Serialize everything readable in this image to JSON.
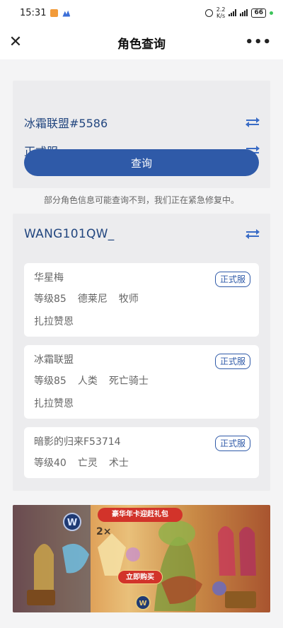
{
  "status_bar": {
    "time": "15:31",
    "rate_top": "2.2",
    "rate_bottom": "K/s",
    "battery": "66",
    "icons": [
      "notification-icon",
      "cloud-icon",
      "alarm-icon",
      "signal-icon",
      "wifi-icon",
      "battery-icon"
    ]
  },
  "nav": {
    "title": "角色查询",
    "close_icon": "close-icon",
    "more_icon": "more-icon"
  },
  "search": {
    "realm": "冰霜联盟#5586",
    "server": "正式服",
    "button": "查询",
    "swap_icon": "swap-icon"
  },
  "notice": "部分角色信息可能查询不到，我们正在紧急修复中。",
  "account": {
    "name": "WANG101QW_"
  },
  "characters": [
    {
      "name": "华星梅",
      "level": "等级85",
      "race": "德莱尼",
      "class": "牧师",
      "realm": "扎拉赞恩",
      "tag": "正式服"
    },
    {
      "name": "冰霜联盟",
      "level": "等级85",
      "race": "人类",
      "class": "死亡骑士",
      "realm": "扎拉赞恩",
      "tag": "正式服"
    },
    {
      "name": "暗影的归来F53714",
      "level": "等级40",
      "race": "亡灵",
      "class": "术士",
      "tag": "正式服"
    }
  ],
  "banner": {
    "headline": "豪华年卡迎赶礼包",
    "button": "立即购买",
    "multiplier": "2×",
    "colors": {
      "accent": "#d2332a",
      "brand": "#2f5aa8"
    }
  }
}
